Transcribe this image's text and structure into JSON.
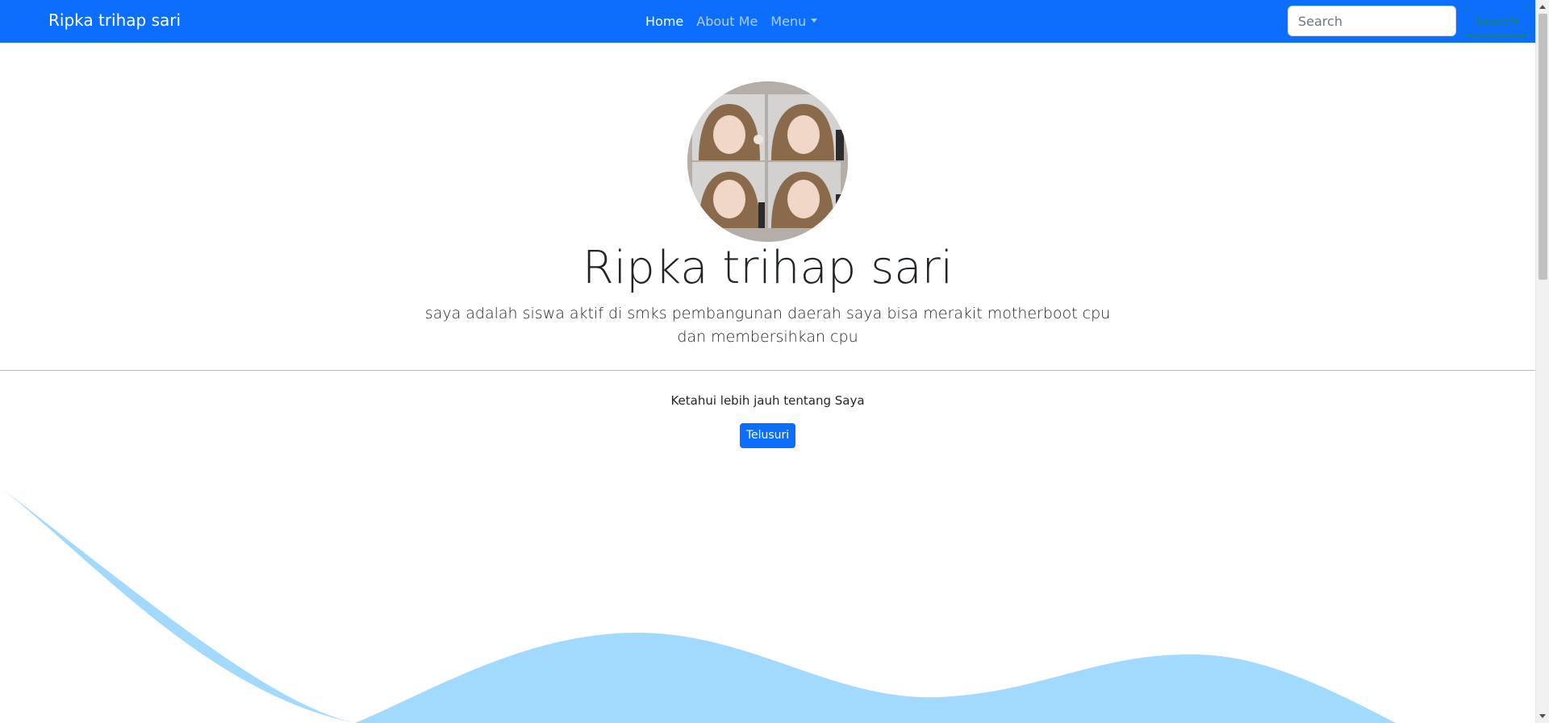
{
  "navbar": {
    "brand": "Ripka trihap sari",
    "links": [
      {
        "label": "Home",
        "active": true
      },
      {
        "label": "About Me",
        "active": false
      },
      {
        "label": "Menu",
        "active": false,
        "dropdown": true
      }
    ],
    "search": {
      "placeholder": "Search",
      "button_label": "Search"
    },
    "background_color": "#0d6efd"
  },
  "hero": {
    "avatar_icon": "profile-photo",
    "title": "Ripka trihap sari",
    "lead": "saya adalah siswa aktif di smks pembangunan daerah saya bisa merakit motherboot cpu dan membersihkan cpu"
  },
  "about": {
    "text": "Ketahui lebih jauh tentang Saya",
    "button_label": "Telusuri"
  },
  "wave": {
    "color": "#a2d9ff"
  }
}
